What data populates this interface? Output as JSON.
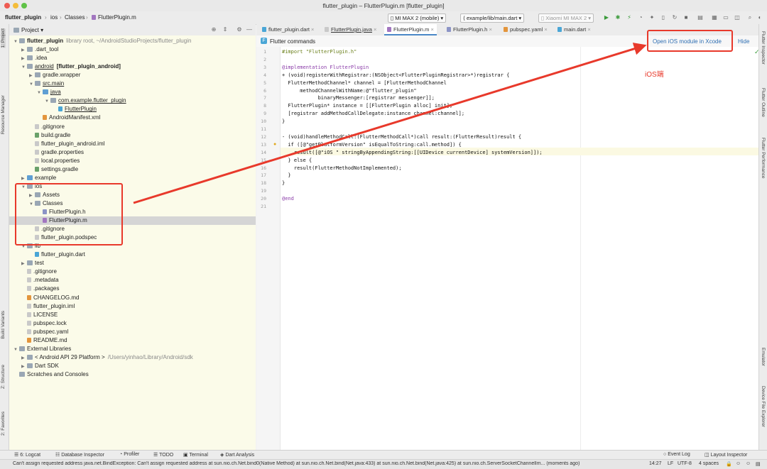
{
  "window": {
    "title": "flutter_plugin – FlutterPlugin.m [flutter_plugin]"
  },
  "breadcrumb": [
    "flutter_plugin",
    "ios",
    "Classes",
    "FlutterPlugin.m"
  ],
  "toolbar": {
    "device": "MI MAX 2 (mobile)",
    "config": "example/lib/main.dart",
    "target": "Xiaomi MI MAX 2"
  },
  "project_panel": {
    "title": "Project",
    "tree": [
      {
        "depth": 0,
        "arrow": "▼",
        "icon": "folder",
        "name": "flutter_plugin",
        "extra": "library root, ~/AndroidStudioProjects/flutter_plugin",
        "bold": true
      },
      {
        "depth": 1,
        "arrow": "▶",
        "icon": "folder",
        "name": ".dart_tool"
      },
      {
        "depth": 1,
        "arrow": "▶",
        "icon": "folder",
        "name": ".idea"
      },
      {
        "depth": 1,
        "arrow": "▼",
        "icon": "folder",
        "name": "android",
        "extra": "[flutter_plugin_android]",
        "ul": true,
        "boldextra": true
      },
      {
        "depth": 2,
        "arrow": "▶",
        "icon": "folder",
        "name": "gradle.wrapper"
      },
      {
        "depth": 2,
        "arrow": "▼",
        "icon": "folder",
        "name": "src.main",
        "ul": true
      },
      {
        "depth": 3,
        "arrow": "▼",
        "icon": "folder src",
        "name": "java",
        "ul": true
      },
      {
        "depth": 4,
        "arrow": "▼",
        "icon": "folder",
        "name": "com.example.flutter_plugin",
        "ul": true
      },
      {
        "depth": 5,
        "arrow": "",
        "icon": "file dart",
        "name": "FlutterPlugin",
        "ul": true
      },
      {
        "depth": 3,
        "arrow": "",
        "icon": "file xml",
        "name": "AndroidManifest.xml"
      },
      {
        "depth": 2,
        "arrow": "",
        "icon": "file",
        "name": ".gitignore"
      },
      {
        "depth": 2,
        "arrow": "",
        "icon": "file gradle",
        "name": "build.gradle"
      },
      {
        "depth": 2,
        "arrow": "",
        "icon": "file",
        "name": "flutter_plugin_android.iml"
      },
      {
        "depth": 2,
        "arrow": "",
        "icon": "file",
        "name": "gradle.properties"
      },
      {
        "depth": 2,
        "arrow": "",
        "icon": "file",
        "name": "local.properties"
      },
      {
        "depth": 2,
        "arrow": "",
        "icon": "file gradle",
        "name": "settings.gradle"
      },
      {
        "depth": 1,
        "arrow": "▶",
        "icon": "folder src",
        "name": "example"
      },
      {
        "depth": 1,
        "arrow": "▼",
        "icon": "folder",
        "name": "ios"
      },
      {
        "depth": 2,
        "arrow": "▶",
        "icon": "folder",
        "name": "Assets"
      },
      {
        "depth": 2,
        "arrow": "▼",
        "icon": "folder",
        "name": "Classes"
      },
      {
        "depth": 3,
        "arrow": "",
        "icon": "file h",
        "name": "FlutterPlugin.h"
      },
      {
        "depth": 3,
        "arrow": "",
        "icon": "file m",
        "name": "FlutterPlugin.m",
        "selected": true
      },
      {
        "depth": 2,
        "arrow": "",
        "icon": "file",
        "name": ".gitignore"
      },
      {
        "depth": 2,
        "arrow": "",
        "icon": "file",
        "name": "flutter_plugin.podspec"
      },
      {
        "depth": 1,
        "arrow": "▼",
        "icon": "folder",
        "name": "lib"
      },
      {
        "depth": 2,
        "arrow": "",
        "icon": "file dart",
        "name": "flutter_plugin.dart"
      },
      {
        "depth": 1,
        "arrow": "▶",
        "icon": "folder",
        "name": "test"
      },
      {
        "depth": 1,
        "arrow": "",
        "icon": "file",
        "name": ".gitignore"
      },
      {
        "depth": 1,
        "arrow": "",
        "icon": "file",
        "name": ".metadata"
      },
      {
        "depth": 1,
        "arrow": "",
        "icon": "file",
        "name": ".packages"
      },
      {
        "depth": 1,
        "arrow": "",
        "icon": "file xml",
        "name": "CHANGELOG.md"
      },
      {
        "depth": 1,
        "arrow": "",
        "icon": "file",
        "name": "flutter_plugin.iml"
      },
      {
        "depth": 1,
        "arrow": "",
        "icon": "file",
        "name": "LICENSE"
      },
      {
        "depth": 1,
        "arrow": "",
        "icon": "file",
        "name": "pubspec.lock"
      },
      {
        "depth": 1,
        "arrow": "",
        "icon": "file",
        "name": "pubspec.yaml"
      },
      {
        "depth": 1,
        "arrow": "",
        "icon": "file xml",
        "name": "README.md"
      },
      {
        "depth": 0,
        "arrow": "▼",
        "icon": "folder",
        "name": "External Libraries"
      },
      {
        "depth": 1,
        "arrow": "▶",
        "icon": "folder",
        "name": "< Android API 29 Platform >",
        "extra": "/Users/yinhao/Library/Android/sdk",
        "dimextra": true
      },
      {
        "depth": 1,
        "arrow": "▶",
        "icon": "folder",
        "name": "Dart SDK"
      },
      {
        "depth": 0,
        "arrow": "",
        "icon": "folder",
        "name": "Scratches and Consoles"
      }
    ]
  },
  "editor": {
    "tabs": [
      {
        "label": "flutter_plugin.dart"
      },
      {
        "label": "FlutterPlugin.java"
      },
      {
        "label": "FlutterPlugin.m",
        "active": true
      },
      {
        "label": "FlutterPlugin.h"
      },
      {
        "label": "pubspec.yaml"
      },
      {
        "label": "main.dart"
      }
    ],
    "banner": {
      "title": "Flutter commands",
      "open_ios": "Open iOS module in Xcode",
      "hide": "Hide"
    },
    "annotation": "iOS端",
    "lines": [
      "#import \"FlutterPlugin.h\"",
      "",
      "@implementation FlutterPlugin",
      "+ (void)registerWithRegistrar:(NSObject<FlutterPluginRegistrar>*)registrar {",
      "  FlutterMethodChannel* channel = [FlutterMethodChannel",
      "      methodChannelWithName:@\"flutter_plugin\"",
      "            binaryMessenger:[registrar messenger]];",
      "  FlutterPlugin* instance = [[FlutterPlugin alloc] init];",
      "  [registrar addMethodCallDelegate:instance channel:channel];",
      "}",
      "",
      "- (void)handleMethodCall:(FlutterMethodCall*)call result:(FlutterResult)result {",
      "  if ([@\"getPlatformVersion\" isEqualToString:call.method]) {",
      "    result([@\"iOS \" stringByAppendingString:[[UIDevice currentDevice] systemVersion]]);",
      "  } else {",
      "    result(FlutterMethodNotImplemented);",
      "  }",
      "}",
      "",
      "@end",
      ""
    ]
  },
  "left_tools": [
    "1: Project",
    "Resource Manager",
    "Build Variants",
    "Z: Structure",
    "2: Favorites"
  ],
  "right_tools": [
    "Flutter Inspector",
    "Flutter Outline",
    "Flutter Performance",
    "Emulator",
    "Device File Explorer"
  ],
  "bottom_tools": [
    "6: Logcat",
    "Database Inspector",
    "Profiler",
    "TODO",
    "Terminal",
    "Dart Analysis"
  ],
  "bottom_right_tools": [
    "Event Log",
    "Layout Inspector"
  ],
  "status": {
    "message": "Can't assign requested address java.net.BindException: Can't assign requested address at sun.nio.ch.Net.bind0(Native Method) at sun.nio.ch.Net.bind(Net.java:433) at sun.nio.ch.Net.bind(Net.java:425) at sun.nio.ch.ServerSocketChannelIm... (moments ago)",
    "position": "14:27",
    "line_sep": "LF",
    "encoding": "UTF-8",
    "indent": "4 spaces"
  },
  "colors": {
    "annotation_red": "#e8392b",
    "link_blue": "#2f6fb3"
  }
}
